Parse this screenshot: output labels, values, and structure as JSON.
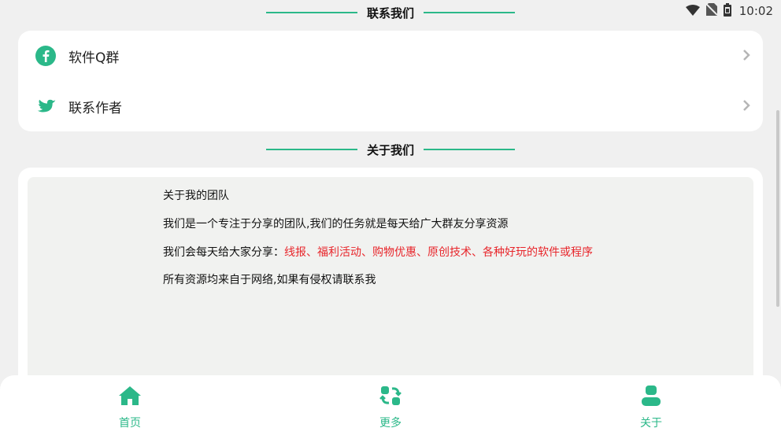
{
  "status_bar": {
    "time": "10:02",
    "icons": [
      "wifi-icon",
      "no-sim-icon",
      "battery-icon"
    ]
  },
  "sections": {
    "contact_title": "联系我们",
    "about_title": "关于我们"
  },
  "contact": {
    "items": [
      {
        "label": "软件Q群",
        "icon": "facebook-icon"
      },
      {
        "label": "联系作者",
        "icon": "twitter-icon"
      }
    ]
  },
  "about": {
    "line1": "关于我的团队",
    "line2": "我们是一个专注于分享的团队,我们的任务就是每天给广大群友分享资源",
    "line3_prefix": "我们会每天给大家分享：",
    "line3_highlight": "线报、福利活动、购物优惠、原创技术、各种好玩的软件或程序",
    "line4": "所有资源均来自于网络,如果有侵权请联系我"
  },
  "bottom_nav": {
    "items": [
      {
        "label": "首页",
        "icon": "home-icon"
      },
      {
        "label": "更多",
        "icon": "more-icon"
      },
      {
        "label": "关于",
        "icon": "user-icon"
      }
    ]
  },
  "colors": {
    "accent": "#2bb889",
    "highlight_text": "#e8262b",
    "background": "#f0f0f0"
  }
}
